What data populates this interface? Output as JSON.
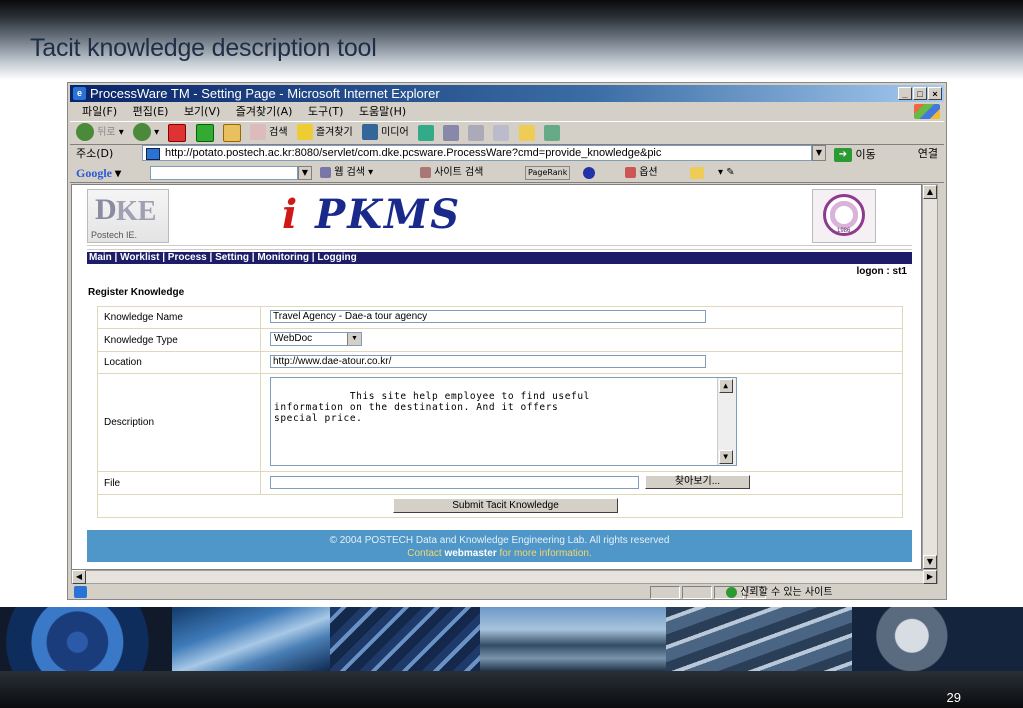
{
  "slide": {
    "title": "Tacit knowledge description tool",
    "page_number": "29"
  },
  "window": {
    "title": "ProcessWare TM - Setting Page - Microsoft Internet Explorer",
    "controls": [
      "_",
      "□",
      "×"
    ]
  },
  "menubar": [
    "파일(F)",
    "편집(E)",
    "보기(V)",
    "즐겨찾기(A)",
    "도구(T)",
    "도움말(H)"
  ],
  "toolbar": {
    "back": "뒤로",
    "search": "검색",
    "favorites": "즐겨찾기",
    "media": "미디어"
  },
  "address": {
    "label": "주소(D)",
    "url": "http://potato.postech.ac.kr:8080/servlet/com.dke.pcsware.ProcessWare?cmd=provide_knowledge&pic",
    "go": "이동",
    "links": "연결"
  },
  "googlebar": {
    "label": "Google",
    "web_search": "웹 검색",
    "site_search": "사이트 검색",
    "pagerank": "PageRank",
    "popup": "옵션"
  },
  "page": {
    "logo_caption": "Postech IE.",
    "brand_i": "i",
    "brand": "PKMS",
    "seal_year": "1986",
    "nav": [
      "Main",
      "Worklist",
      "Process",
      "Setting",
      "Monitoring",
      "Logging"
    ],
    "logon": "logon : st1",
    "section_title": "Register Knowledge",
    "form": {
      "name_label": "Knowledge Name",
      "name_value": "Travel Agency - Dae-a tour agency",
      "type_label": "Knowledge Type",
      "type_value": "WebDoc",
      "location_label": "Location",
      "location_value": "http://www.dae-atour.co.kr/",
      "description_label": "Description",
      "description_value": "This site help employee to find useful\ninformation on the destination. And it offers\nspecial price.",
      "file_label": "File",
      "file_value": "",
      "browse": "찾아보기...",
      "submit": "Submit Tacit Knowledge"
    },
    "footer": {
      "line1": "© 2004 POSTECH Data and Knowledge Engineering Lab. All rights reserved",
      "contact": "Contact",
      "webmaster": "webmaster",
      "more": "for more information."
    }
  },
  "status": {
    "zone": "신뢰할 수 있는 사이트"
  },
  "colors": {
    "titlebar": "#0a246a",
    "nav_bg": "#1c1c68",
    "footer_bg": "#4f97c8",
    "brand": "#1a2a8a",
    "brand_i": "#d01818"
  }
}
